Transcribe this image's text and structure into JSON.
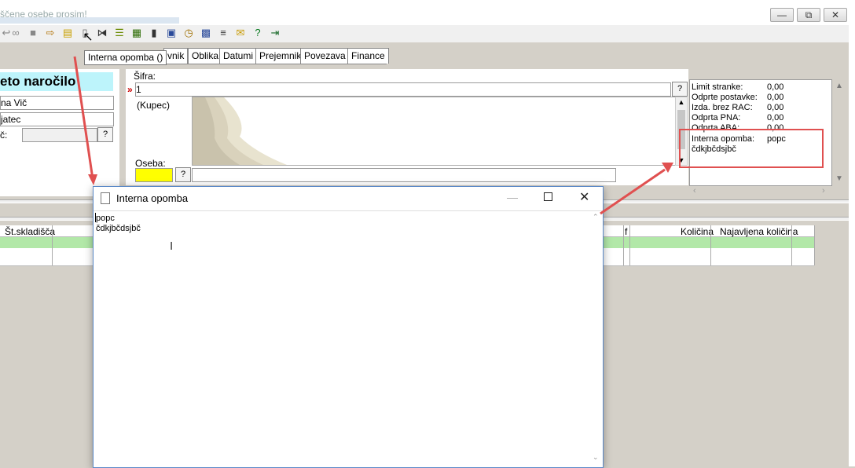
{
  "window": {
    "title": "ščene osebe prosim!"
  },
  "toolbar": {
    "tooltip": "Interna opomba ()"
  },
  "tabs": [
    "vnik",
    "Oblika",
    "Datumi",
    "Prejemnik",
    "Povezava",
    "Finance"
  ],
  "left": {
    "heading": "eto naročilo",
    "field1": "na Vič",
    "field2": "jatec",
    "field3_label": "č:",
    "q": "?"
  },
  "mid": {
    "sifra_label": "Šifra:",
    "sifra_value": "1",
    "kupec_label": "(Kupec)",
    "oseba_label": "Oseba:",
    "q": "?"
  },
  "stats": [
    {
      "label": "Limit stranke:",
      "value": "0,00"
    },
    {
      "label": "Odprte postavke:",
      "value": "0,00"
    },
    {
      "label": "Izda. brez RAC:",
      "value": "0,00"
    },
    {
      "label": "Odprta PNA:",
      "value": "0,00"
    },
    {
      "label": "Odprta ABA:",
      "value": "0,00"
    },
    {
      "label": "Interna opomba:",
      "value": "popc"
    },
    {
      "label": "čdkjbčdsjbč",
      "value": ""
    }
  ],
  "grid": {
    "col_skladisca": "Št.skladišča",
    "col_f": "f",
    "col_kolicina": "Količina",
    "col_najavljena": "Najavljena količina"
  },
  "dialog": {
    "title": "Interna opomba",
    "line1": "popc",
    "line2": "čdkjbčdsjbč"
  },
  "colors": {
    "accent_cyan": "#bdf4fb",
    "highlight_yellow": "#ffff00",
    "grid_green": "#b2e8a8",
    "annotation_red": "#e05050"
  }
}
